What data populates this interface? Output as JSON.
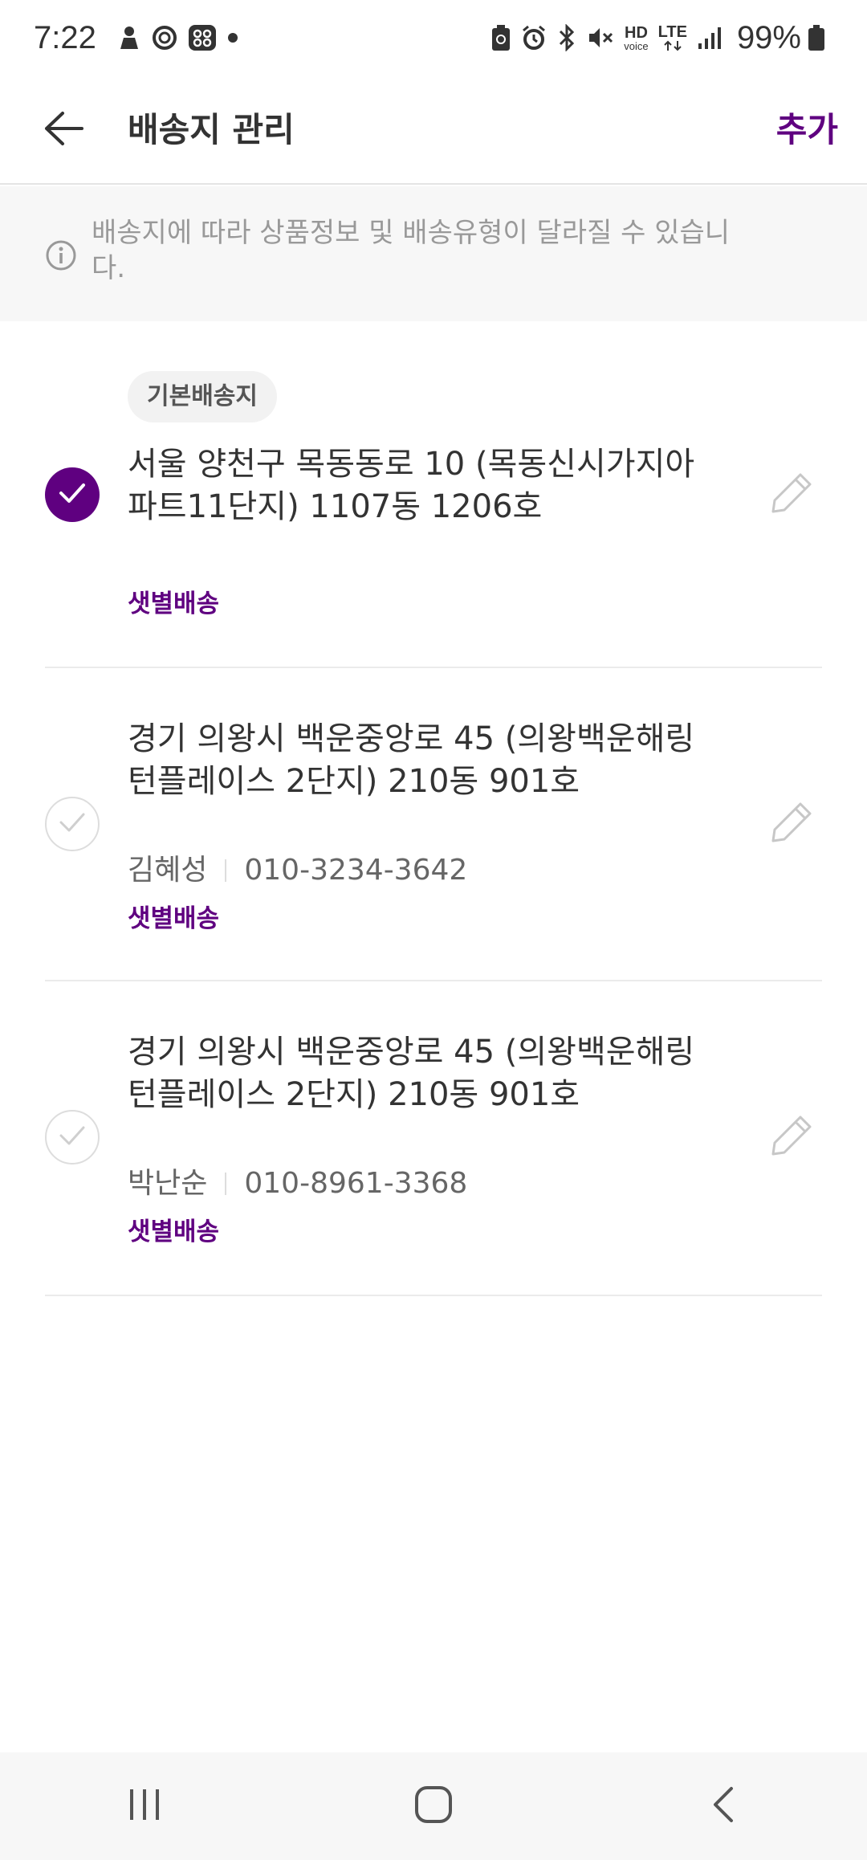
{
  "status_bar": {
    "time": "7:22",
    "battery_percent": "99%",
    "hd_label": "HD",
    "voice_label": "voice",
    "lte_label": "LTE"
  },
  "header": {
    "title": "배송지 관리",
    "add_label": "추가"
  },
  "notice": {
    "text": "배송지에 따라 상품정보 및 배송유형이 달라질 수 있습니다."
  },
  "addresses": [
    {
      "badge": "기본배송지",
      "address": "서울 양천구 목동동로 10 (목동신시가지아파트11단지) 1107동 1206호",
      "name": "",
      "phone": "",
      "delivery_type": "샛별배송",
      "selected": true
    },
    {
      "badge": "",
      "address": "경기 의왕시 백운중앙로 45 (의왕백운해링턴플레이스 2단지) 210동 901호",
      "name": "김혜성",
      "phone": "010-3234-3642",
      "delivery_type": "샛별배송",
      "selected": false
    },
    {
      "badge": "",
      "address": "경기 의왕시 백운중앙로 45 (의왕백운해링턴플레이스 2단지) 210동 901호",
      "name": "박난순",
      "phone": "010-8961-3368",
      "delivery_type": "샛별배송",
      "selected": false
    }
  ],
  "colors": {
    "accent": "#5f0080",
    "text": "#333333",
    "muted": "#999999",
    "notice_bg": "#f7f7f7",
    "badge_bg": "#f2f2f2"
  },
  "icons": {
    "back": "arrow-left-icon",
    "info": "info-circle-icon",
    "check": "check-icon",
    "edit": "pencil-icon",
    "nav_recents": "recents-icon",
    "nav_home": "home-icon",
    "nav_back": "chevron-left-icon"
  }
}
